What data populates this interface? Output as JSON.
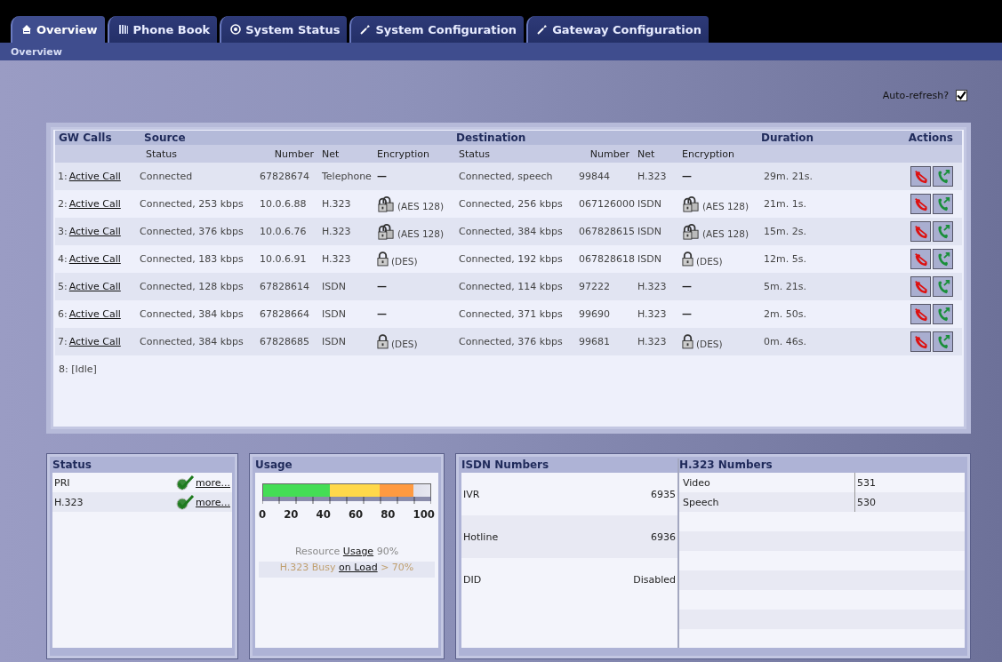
{
  "tabs": [
    {
      "label": "Overview",
      "selected": true
    },
    {
      "label": "Phone Book",
      "selected": false
    },
    {
      "label": "System Status",
      "selected": false
    },
    {
      "label": "System Configuration",
      "selected": false
    },
    {
      "label": "Gateway Configuration",
      "selected": false
    }
  ],
  "breadcrumb": "Overview",
  "auto_refresh": {
    "label": "Auto-refresh?",
    "checked": true
  },
  "calls": {
    "group_headers": [
      "GW Calls",
      "Source",
      "Destination",
      "Duration",
      "Actions"
    ],
    "columns": [
      "Status",
      "Number",
      "Net",
      "Encryption",
      "Status",
      "Number",
      "Net",
      "Encryption"
    ],
    "rows": [
      {
        "kind": "active",
        "index": "1:",
        "link": "Active Call",
        "src_status": "Connected",
        "src_number": "67828674",
        "src_net": "Telephone",
        "src_enc": "—",
        "dst_status": "Connected, speech",
        "dst_number": "99844",
        "dst_net": "H.323",
        "dst_enc": "—",
        "duration": "29m. 21s."
      },
      {
        "kind": "active",
        "index": "2:",
        "link": "Active Call",
        "src_status": "Connected, 253 kbps",
        "src_number": "10.0.6.88",
        "src_net": "H.323",
        "src_enc": "(AES 128)",
        "dst_status": "Connected, 256 kbps",
        "dst_number": "067126000",
        "dst_net": "ISDN",
        "dst_enc": "(AES 128)",
        "duration": "21m. 1s."
      },
      {
        "kind": "active",
        "index": "3:",
        "link": "Active Call",
        "src_status": "Connected, 376 kbps",
        "src_number": "10.0.6.76",
        "src_net": "H.323",
        "src_enc": "(AES 128)",
        "dst_status": "Connected, 384 kbps",
        "dst_number": "067828615",
        "dst_net": "ISDN",
        "dst_enc": "(AES 128)",
        "duration": "15m. 2s."
      },
      {
        "kind": "active",
        "index": "4:",
        "link": "Active Call",
        "src_status": "Connected, 183 kbps",
        "src_number": "10.0.6.91",
        "src_net": "H.323",
        "src_enc": "(DES)",
        "dst_status": "Connected, 192 kbps",
        "dst_number": "067828618",
        "dst_net": "ISDN",
        "dst_enc": "(DES)",
        "duration": "12m. 5s."
      },
      {
        "kind": "active",
        "index": "5:",
        "link": "Active Call",
        "src_status": "Connected, 128 kbps",
        "src_number": "67828614",
        "src_net": "ISDN",
        "src_enc": "—",
        "dst_status": "Connected, 114 kbps",
        "dst_number": "97222",
        "dst_net": "H.323",
        "dst_enc": "—",
        "duration": "5m. 21s."
      },
      {
        "kind": "active",
        "index": "6:",
        "link": "Active Call",
        "src_status": "Connected, 384 kbps",
        "src_number": "67828664",
        "src_net": "ISDN",
        "src_enc": "—",
        "dst_status": "Connected, 371 kbps",
        "dst_number": "99690",
        "dst_net": "H.323",
        "dst_enc": "—",
        "duration": "2m. 50s."
      },
      {
        "kind": "active",
        "index": "7:",
        "link": "Active Call",
        "src_status": "Connected, 384 kbps",
        "src_number": "67828685",
        "src_net": "ISDN",
        "src_enc": "(DES)",
        "dst_status": "Connected, 376 kbps",
        "dst_number": "99681",
        "dst_net": "H.323",
        "dst_enc": "(DES)",
        "duration": "0m. 46s."
      },
      {
        "kind": "idle",
        "index": "8:",
        "label": "[Idle]"
      }
    ]
  },
  "status": {
    "title": "Status",
    "items": [
      {
        "name": "PRI",
        "ok": true,
        "link": "more..."
      },
      {
        "name": "H.323",
        "ok": true,
        "link": "more..."
      }
    ]
  },
  "usage": {
    "title": "Usage",
    "ticks": [
      "0",
      "20",
      "40",
      "60",
      "80",
      "100"
    ],
    "line1": {
      "before": "Resource",
      "link": "Usage",
      "after": "90%"
    },
    "line2": {
      "before": "H.323 Busy",
      "link": "on Load",
      "after": "> 70%"
    }
  },
  "isdn_numbers": {
    "title": "ISDN Numbers",
    "rows": [
      {
        "name": "IVR",
        "value": "6935"
      },
      {
        "name": "Hotline",
        "value": "6936"
      },
      {
        "name": "DID",
        "value": "Disabled"
      }
    ]
  },
  "h323_numbers": {
    "title": "H.323 Numbers",
    "rows": [
      {
        "name": "Video",
        "value": "531"
      },
      {
        "name": "Speech",
        "value": "530"
      }
    ]
  }
}
